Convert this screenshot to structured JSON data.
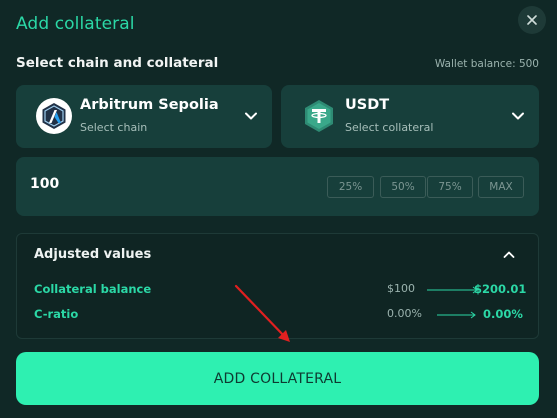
{
  "modal": {
    "title": "Add collateral",
    "section_label": "Select chain and collateral",
    "wallet_balance": "Wallet balance: 500"
  },
  "chain_select": {
    "name": "Arbitrum Sepolia",
    "sub": "Select chain",
    "icon": "arbitrum-logo-icon"
  },
  "collateral_select": {
    "name": "USDT",
    "sub": "Select collateral",
    "icon": "tether-logo-icon"
  },
  "amount": {
    "value": "100",
    "presets": [
      "25%",
      "50%",
      "75%",
      "MAX"
    ]
  },
  "adjusted": {
    "title": "Adjusted values",
    "rows": [
      {
        "label": "Collateral balance",
        "from": "$100",
        "to": "$200.01"
      },
      {
        "label": "C-ratio",
        "from": "0.00%",
        "to": "0.00%"
      }
    ]
  },
  "cta": {
    "label": "ADD COLLATERAL"
  },
  "colors": {
    "accent": "#2bd8a6",
    "button": "#2ef0b1",
    "panel": "#173f3b",
    "background": "#102826",
    "annotation_arrow": "#e02020"
  }
}
